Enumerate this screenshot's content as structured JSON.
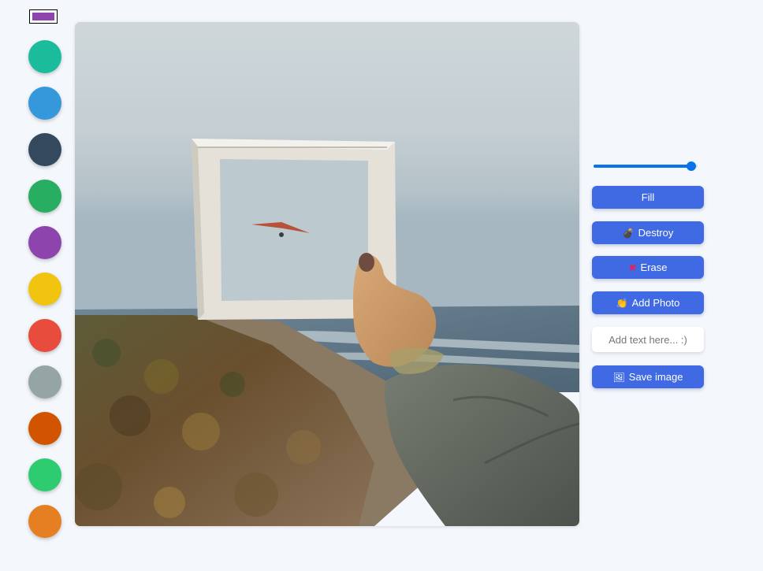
{
  "palette": {
    "selected_color": "#8e44ad",
    "colors": [
      {
        "name": "teal",
        "hex": "#1abc9c"
      },
      {
        "name": "blue",
        "hex": "#3498db"
      },
      {
        "name": "navy",
        "hex": "#34495e"
      },
      {
        "name": "green",
        "hex": "#27ae60"
      },
      {
        "name": "purple",
        "hex": "#8e44ad"
      },
      {
        "name": "yellow",
        "hex": "#f1c40f"
      },
      {
        "name": "red",
        "hex": "#e74c3c"
      },
      {
        "name": "gray",
        "hex": "#95a5a6"
      },
      {
        "name": "dark-orange",
        "hex": "#d35400"
      },
      {
        "name": "emerald",
        "hex": "#2ecc71"
      },
      {
        "name": "orange",
        "hex": "#e67e22"
      }
    ]
  },
  "canvas": {
    "image": "hand-holding-picture-frame-photo"
  },
  "controls": {
    "brush_size": {
      "value": 0.94
    },
    "fill_label": "Fill",
    "destroy": {
      "icon": "bomb-icon",
      "label": "Destroy"
    },
    "erase": {
      "icon": "cross-mark-icon",
      "label": "Erase"
    },
    "add_photo": {
      "icon": "hand-icon",
      "label": "Add Photo"
    },
    "text_placeholder": "Add text here... :)",
    "save": {
      "icon": "frame-icon",
      "label": "Save image"
    },
    "accent": "#4069e4",
    "slider_color": "#0a73ec"
  }
}
